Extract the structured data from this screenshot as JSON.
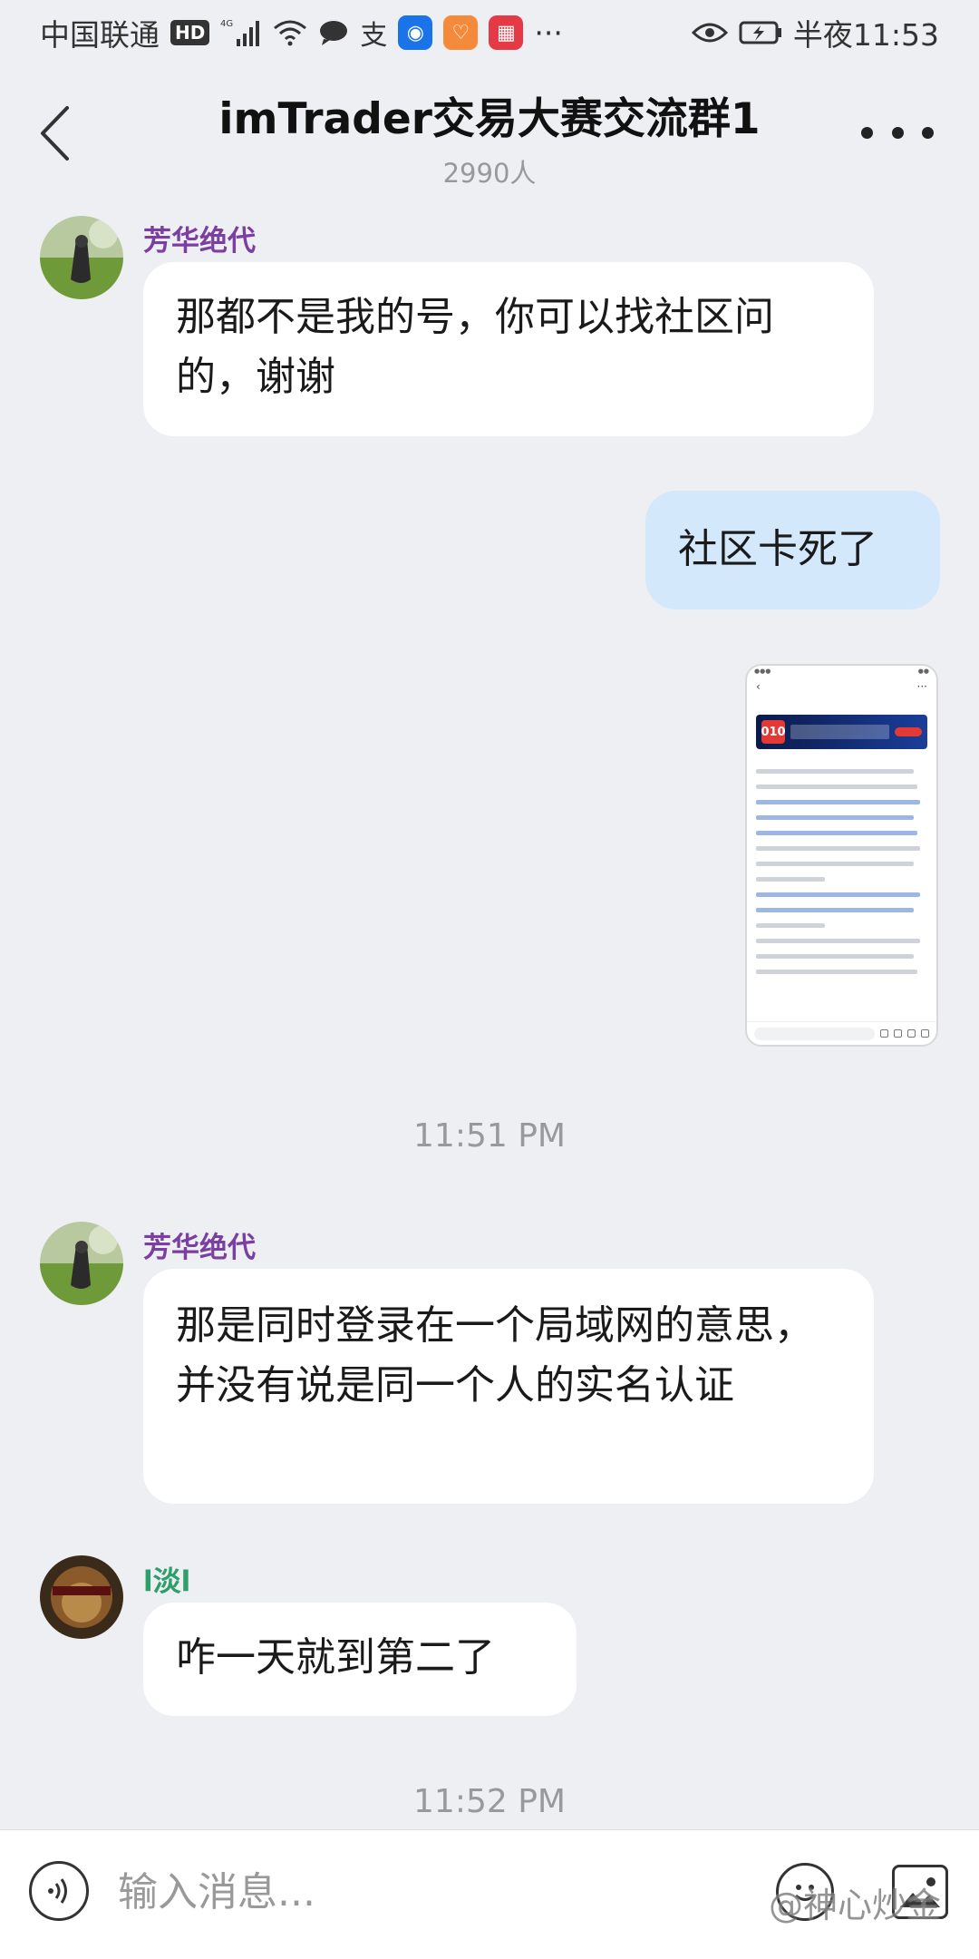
{
  "status_bar": {
    "carrier": "中国联通",
    "hd": "HD",
    "network": "4G",
    "more": "···",
    "time": "半夜11:53"
  },
  "header": {
    "title": "imTrader交易大赛交流群1",
    "member_count": "2990人"
  },
  "messages": [
    {
      "sender": "芳华绝代",
      "sender_color": "#7a3fa0",
      "text": "那都不是我的号，你可以找社区问的，谢谢"
    },
    {
      "sender": "me",
      "text": "社区卡死了"
    },
    {
      "sender": "me",
      "type": "image",
      "thumbnail": {
        "logo_text": "010",
        "lines": [
          "社区的小伙伴们，大家好！",
          "近日小秘书收到多名用户举报，经核实，用户",
          "@芳华绝代、@TVB63、@doo 小公主、",
          "@3409358、@国森密得瑟、@教世主 天涯、",
          "@南南 存在私下拉客、留有观摩账号密码、代",
          "客操盘、发布广告行为，已违反《社区守则》",
          "第3、4、10条，现对以上用户予以禁言30天的",
          "处罚。",
          "另外，经核查，用户@芳华绝代、@有个姑娘",
          "叫小芳、@兔八、@黄金2021、@情敌巴菲特",
          "5名用户所属IP地址为同一个。",
          "对于每一位用户的有效举报小秘书都会仔细核",
          "实，非常感谢各位对建设和谐社区做出的贡",
          "献。关于近日的事件小秘书有话想说："
        ]
      }
    },
    {
      "timestamp": "11:51 PM"
    },
    {
      "sender": "芳华绝代",
      "sender_color": "#7a3fa0",
      "text": "那是同时登录在一个局域网的意思，并没有说是同一个人的实名认证"
    },
    {
      "sender": "l淡l",
      "sender_color": "#2e9e6b",
      "text": "咋一天就到第二了"
    },
    {
      "timestamp": "11:52 PM"
    }
  ],
  "input": {
    "placeholder": "输入消息..."
  },
  "watermark": "@神心炒金",
  "colors": {
    "background": "#eeeff3",
    "my_bubble": "#d3e8fb",
    "other_bubble": "#ffffff"
  }
}
